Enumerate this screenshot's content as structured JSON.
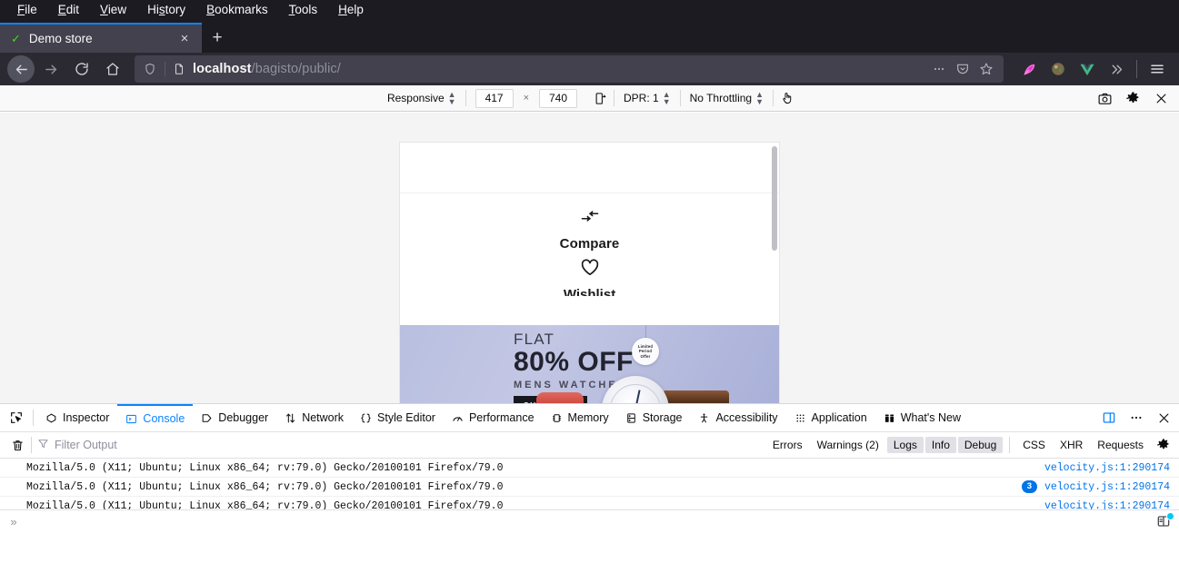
{
  "menubar": {
    "items": [
      {
        "label": "File",
        "accel": "F"
      },
      {
        "label": "Edit",
        "accel": "E"
      },
      {
        "label": "View",
        "accel": "V"
      },
      {
        "label": "History",
        "accel": "s"
      },
      {
        "label": "Bookmarks",
        "accel": "B"
      },
      {
        "label": "Tools",
        "accel": "T"
      },
      {
        "label": "Help",
        "accel": "H"
      }
    ]
  },
  "tabstrip": {
    "tab": {
      "title": "Demo store",
      "favicon": "checkmark-icon",
      "close_label": "×"
    },
    "new_tab_label": "+"
  },
  "navbar": {
    "back_icon": "back-arrow-icon",
    "forward_icon": "forward-arrow-icon",
    "reload_icon": "reload-icon",
    "home_icon": "home-icon",
    "url_host": "localhost",
    "url_path": "/bagisto/public/",
    "shield_icon": "shield-icon",
    "page_icon": "page-icon",
    "more_icon": "ellipsis-icon",
    "pocket_icon": "pocket-icon",
    "bookmark_icon": "star-icon",
    "extensions": [
      "feather-icon",
      "globe-avatar-icon",
      "vue-devtools-icon"
    ],
    "overflow_icon": "chevron-double-right-icon",
    "menu_icon": "hamburger-menu-icon"
  },
  "rdm": {
    "device": "Responsive",
    "width": "417",
    "height": "740",
    "times": "×",
    "rotate_icon": "rotate-viewport-icon",
    "dpr": "DPR: 1",
    "throttling": "No Throttling",
    "touch_icon": "touch-simulation-icon",
    "camera_icon": "screenshot-camera-icon",
    "settings_icon": "gear-icon",
    "close_icon": "close-icon"
  },
  "viewport": {
    "menu": {
      "compare_icon": "compare-arrows-icon",
      "compare_label": "Compare",
      "wishlist_icon": "heart-icon",
      "wishlist_label": "Wishlist"
    },
    "banner": {
      "flat": "FLAT",
      "discount": "80% OFF",
      "category": "MENS WATCHES",
      "cta": "SHOP NOW",
      "badge_line1": "Limited",
      "badge_line2": "Period",
      "badge_line3": "Offer"
    },
    "scrollbar": "vertical-scrollbar"
  },
  "devtools": {
    "picker_icon": "element-picker-icon",
    "tabs": [
      {
        "label": "Inspector",
        "icon": "inspector-icon",
        "active": false
      },
      {
        "label": "Console",
        "icon": "console-icon",
        "active": true
      },
      {
        "label": "Debugger",
        "icon": "debugger-icon",
        "active": false
      },
      {
        "label": "Network",
        "icon": "network-icon",
        "active": false
      },
      {
        "label": "Style Editor",
        "icon": "style-editor-icon",
        "active": false
      },
      {
        "label": "Performance",
        "icon": "performance-icon",
        "active": false
      },
      {
        "label": "Memory",
        "icon": "memory-icon",
        "active": false
      },
      {
        "label": "Storage",
        "icon": "storage-icon",
        "active": false
      },
      {
        "label": "Accessibility",
        "icon": "accessibility-icon",
        "active": false
      },
      {
        "label": "Application",
        "icon": "application-icon",
        "active": false
      },
      {
        "label": "What's New",
        "icon": "whats-new-icon",
        "active": false
      }
    ],
    "dock_icon": "dock-to-side-icon",
    "meatball_icon": "ellipsis-icon",
    "close_icon": "close-icon",
    "filterbar": {
      "trash_icon": "trash-icon",
      "filter_icon": "funnel-icon",
      "filter_placeholder": "Filter Output",
      "filters": [
        {
          "label": "Errors",
          "on": false
        },
        {
          "label": "Warnings (2)",
          "on": false
        },
        {
          "label": "Logs",
          "on": true
        },
        {
          "label": "Info",
          "on": true
        },
        {
          "label": "Debug",
          "on": true
        },
        {
          "label": "CSS",
          "on": false
        },
        {
          "label": "XHR",
          "on": false
        },
        {
          "label": "Requests",
          "on": false
        }
      ],
      "settings_icon": "gear-icon"
    },
    "log_rows": [
      {
        "message": "Mozilla/5.0 (X11; Ubuntu; Linux x86_64; rv:79.0) Gecko/20100101 Firefox/79.0",
        "source": "velocity.js:1:290174",
        "count": ""
      },
      {
        "message": "Mozilla/5.0 (X11; Ubuntu; Linux x86_64; rv:79.0) Gecko/20100101 Firefox/79.0",
        "source": "velocity.js:1:290174",
        "count": "3"
      },
      {
        "message": "Mozilla/5.0 (X11; Ubuntu; Linux x86_64; rv:79.0) Gecko/20100101 Firefox/79.0",
        "source": "velocity.js:1:290174",
        "count": ""
      }
    ],
    "prompt": {
      "chevron": "»",
      "value": "",
      "editor_icon": "split-console-editor-icon"
    }
  },
  "colors": {
    "chrome_dark": "#1c1b22",
    "chrome_nav": "#2b2a33",
    "tab_active": "#42414d",
    "accent_blue": "#0a84ff",
    "link_blue": "#0074e8",
    "favicon_green": "#30e60b",
    "canvas_gray": "#f4f4f4",
    "banner_lavender": "#b9bfe0"
  }
}
